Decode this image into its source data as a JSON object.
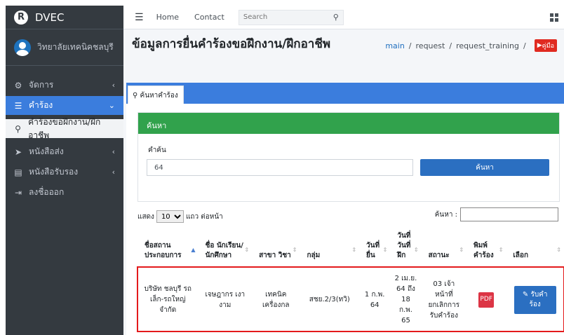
{
  "brand": {
    "logo": "R",
    "name": "DVEC"
  },
  "user": {
    "name": "วิทยาลัยเทคนิคชลบุรี"
  },
  "sidebar": {
    "items": [
      {
        "icon": "gears-icon",
        "glyph": "⚙",
        "label": "จัดการ",
        "caret": "‹"
      },
      {
        "icon": "list-icon",
        "glyph": "☰",
        "label": "คำร้อง",
        "caret": "⌄"
      },
      {
        "icon": "user-icon",
        "glyph": "⚲",
        "label": "คำร้องขอฝึกงาน/ฝึกอาชีพ"
      },
      {
        "icon": "paper-plane-icon",
        "glyph": "➤",
        "label": "หนังสือส่ง",
        "caret": "‹"
      },
      {
        "icon": "document-icon",
        "glyph": "▤",
        "label": "หนังสือรับรอง",
        "caret": "‹"
      },
      {
        "icon": "sign-out-icon",
        "glyph": "⇥",
        "label": "ลงชื่อออก"
      }
    ]
  },
  "topbar": {
    "home": "Home",
    "contact": "Contact",
    "search_placeholder": "Search"
  },
  "page": {
    "title": "ข้อมูลการยื่นคำร้องขอฝึกงาน/ฝึกอาชีพ",
    "breadcrumb": [
      "main",
      "request",
      "request_training"
    ],
    "guide_label": "คู่มือ"
  },
  "tab": {
    "label": "ค้นหาคำร้อง"
  },
  "search_panel": {
    "header": "ค้นหา",
    "field_label": "คำค้น",
    "field_value": "64",
    "button": "ค้นหา"
  },
  "datatable": {
    "show_prefix": "แสดง",
    "page_size": "10",
    "show_suffix": "แถว ต่อหน้า",
    "filter_label": "ค้นหา :",
    "columns": [
      {
        "label": "ชื่อสถาน ประกอบการ"
      },
      {
        "label": "ชื่อ นักเรียน/ นักศึกษา"
      },
      {
        "label": "สาขา วิชา"
      },
      {
        "label": "กลุ่ม"
      },
      {
        "label": "วันที่ ยื่น"
      },
      {
        "label": "วันที่ วันที่ ฝึก"
      },
      {
        "label": "สถานะ"
      },
      {
        "label": "พิมพ์ คำร้อง"
      },
      {
        "label": "เลือก"
      }
    ],
    "row": {
      "company": "บริษัท ชลบุรี รถเล็ก-รถใหญ่ จำกัด",
      "student": "เจษฎากร เงา งาม",
      "major": "เทคนิค เครื่องกล",
      "group": "สชย.2/3(ทวิ)",
      "submit_date": "1 ก.พ. 64",
      "training_date": "2 เม.ย. 64 ถึง 18 ก.พ. 65",
      "status": "03 เจ้า หน้าที่ ยกเลิกการ รับคำร้อง",
      "print_icon": "pdf-icon",
      "accept_label": "รับคำ ร้อง"
    }
  },
  "colors": {
    "sidebar": "#343a40",
    "accent": "#3b7ddd",
    "success": "#31a24c",
    "danger": "#dc3545",
    "highlight": "#e41a1c"
  }
}
